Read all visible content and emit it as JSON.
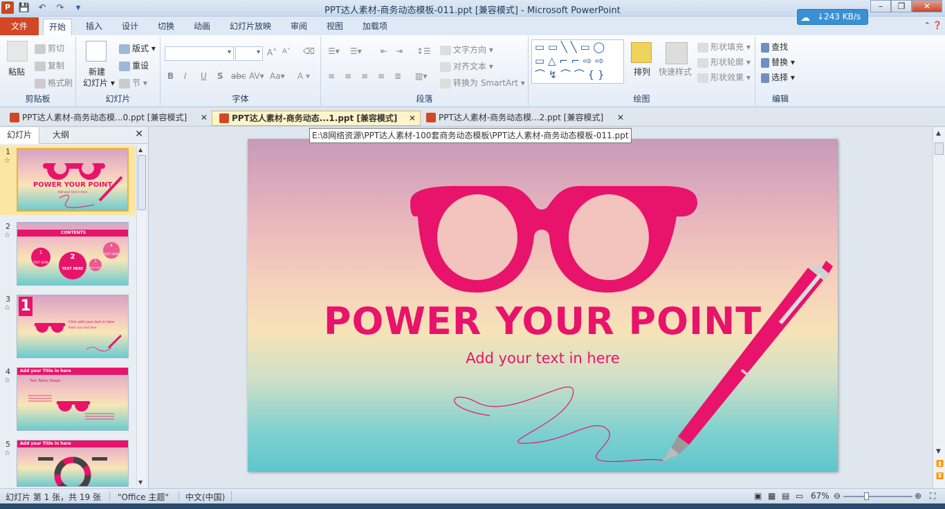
{
  "window": {
    "title": "PPT达人素材-商务动态模板-011.ppt [兼容模式]  -  Microsoft PowerPoint",
    "app_icon": "P",
    "net_speed": "↓243 KB/s"
  },
  "ribbon_tabs": [
    "文件",
    "开始",
    "插入",
    "设计",
    "切换",
    "动画",
    "幻灯片放映",
    "审阅",
    "视图",
    "加载项"
  ],
  "ribbon": {
    "clipboard": {
      "paste": "粘贴",
      "cut": "剪切",
      "copy": "复制",
      "format_painter": "格式刷",
      "label": "剪贴板"
    },
    "slides": {
      "new_slide": "新建",
      "new_slide_2": "幻灯片",
      "layout": "版式",
      "reset": "重设",
      "section": "节",
      "label": "幻灯片"
    },
    "font": {
      "label": "字体",
      "bold": "B",
      "italic": "I",
      "underline": "U",
      "shadow": "S",
      "strike": "abc",
      "spacing": "AV",
      "case": "Aa",
      "grow": "A",
      "shrink": "A"
    },
    "paragraph": {
      "text_direction": "文字方向",
      "align_text": "对齐文本",
      "smartart": "转换为 SmartArt",
      "label": "段落"
    },
    "drawing": {
      "arrange": "排列",
      "quick_styles": "快速样式",
      "shape_fill": "形状填充",
      "shape_outline": "形状轮廓",
      "shape_effects": "形状效果",
      "label": "绘图"
    },
    "editing": {
      "find": "查找",
      "replace": "替换",
      "select": "选择",
      "label": "编辑"
    }
  },
  "doc_tabs": [
    {
      "label": "PPT达人素材-商务动态模...0.ppt [兼容模式]",
      "active": false
    },
    {
      "label": "PPT达人素材-商务动态...1.ppt [兼容模式]",
      "active": true
    },
    {
      "label": "PPT达人素材-商务动态模...2.ppt [兼容模式]",
      "active": false
    }
  ],
  "tooltip": "E:\\8网络资源\\PPT达人素材-100套商务动态模板\\PPT达人素材-商务动态模板-011.ppt",
  "left_pane": {
    "tabs": [
      "幻灯片",
      "大纲"
    ],
    "slides": [
      {
        "num": "1",
        "title": "POWER YOUR POINT",
        "sub": "Add your text in here"
      },
      {
        "num": "2",
        "title": "CONTENTS",
        "items": [
          "TEXT HERE",
          "TEXT HERE",
          "TEXT HERE",
          "TEXT HERE"
        ],
        "nums": [
          "1",
          "2",
          "3",
          "4"
        ]
      },
      {
        "num": "3",
        "big": "1",
        "text": "Click add your text in here",
        "sub": "Enter your text here"
      },
      {
        "num": "4",
        "title": "Add your Title in here",
        "sub": "Text Tables Shape"
      },
      {
        "num": "5",
        "title": "Add your Title in here"
      }
    ]
  },
  "slide": {
    "title": "POWER YOUR POINT",
    "subtitle": "Add your text in here",
    "accent_color": "#e8136a"
  },
  "status": {
    "slide_info": "幻灯片 第 1 张，共 19 张",
    "theme": "\"Office 主题\"",
    "language": "中文(中国)",
    "zoom": "67%"
  }
}
